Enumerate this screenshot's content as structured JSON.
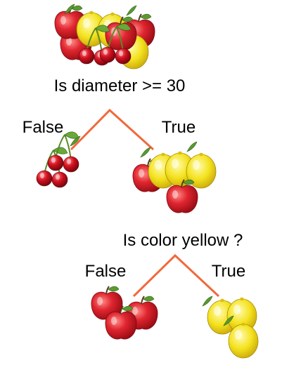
{
  "nodes": {
    "root_question": "Is diameter >= 30",
    "root_false_label": "False",
    "root_true_label": "True",
    "second_question": "Is color yellow ?",
    "second_false_label": "False",
    "second_true_label": "True"
  },
  "icons": {
    "cherry": "cherry-icon",
    "apple": "apple-icon",
    "lemon": "lemon-icon"
  },
  "colors": {
    "branch": "#f06a3c",
    "apple": "#d8202a",
    "cherry": "#c4101c",
    "lemon": "#f2e020",
    "leaf": "#4d8a2a"
  }
}
